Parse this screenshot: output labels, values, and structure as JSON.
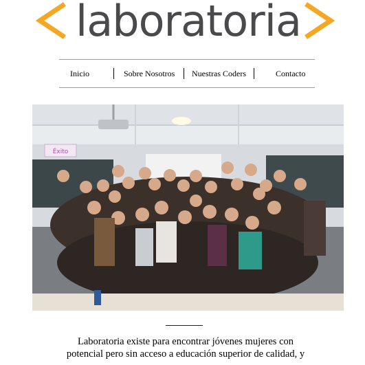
{
  "logo": {
    "left_bracket": "<",
    "wordmark": "laboratoria",
    "right_bracket": ">",
    "bracket_color": "#f5a623",
    "text_color": "#4a4a4c"
  },
  "nav": {
    "items": [
      {
        "label": "Inicio"
      },
      {
        "label": "Sobre Nosotros"
      },
      {
        "label": "Nuestras Coders"
      },
      {
        "label": "Contacto"
      }
    ]
  },
  "photo": {
    "alt": "Grupo de estudiantes de Laboratoria en un aula",
    "sign_text": "Éxito"
  },
  "intro": {
    "line1": "Laboratoria existe para encontrar jóvenes mujeres con",
    "line2": "potencial pero sin acceso a educación superior de calidad, y"
  }
}
